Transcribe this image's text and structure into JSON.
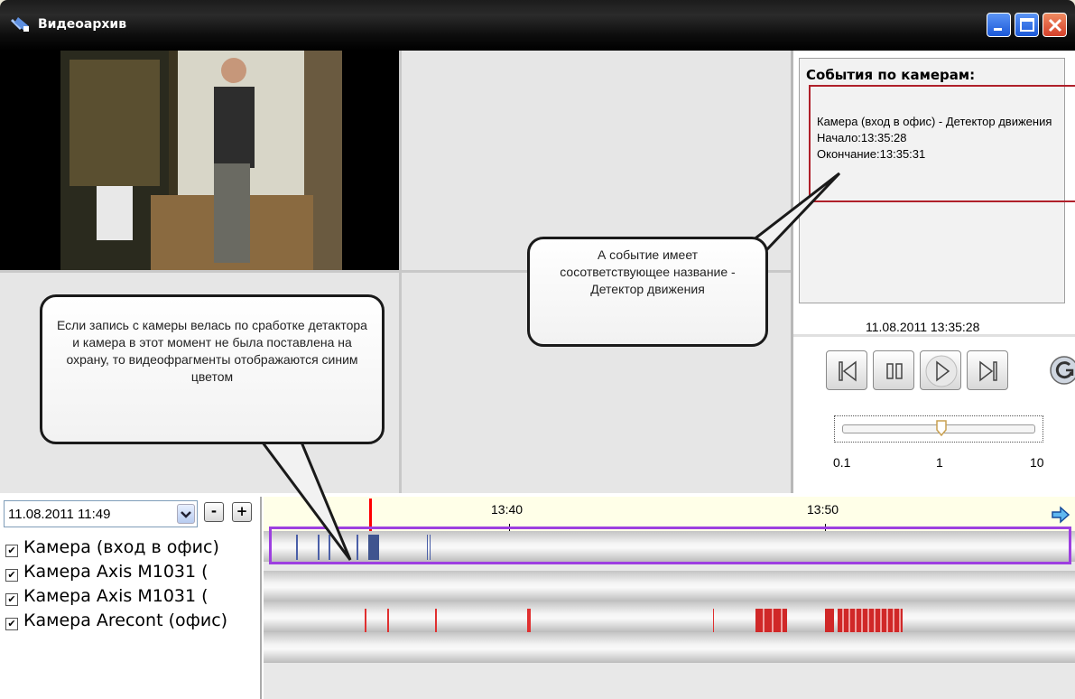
{
  "window": {
    "title": "Видеоархив"
  },
  "events": {
    "title": "События по камерам:",
    "entry": {
      "name": "Камера (вход в офис) - Детектор движения",
      "start": "Начало:13:35:28",
      "end": "Окончание:13:35:31"
    }
  },
  "player": {
    "datetime": "11.08.2011 13:35:28",
    "speed_labels": [
      "0.1",
      "1",
      "10"
    ],
    "speed_value": 1
  },
  "timeline": {
    "date_value": "11.08.2011 11:49",
    "minus_label": "-",
    "plus_label": "+",
    "tick_labels": [
      "13:40",
      "13:50"
    ],
    "cameras": [
      {
        "label": "Камера (вход в офис)",
        "checked": true
      },
      {
        "label": "Камера Axis M1031 (",
        "checked": true
      },
      {
        "label": "Камера Axis M1031 (",
        "checked": true
      },
      {
        "label": "Камера Arecont (офис)",
        "checked": true
      }
    ],
    "colors": {
      "blue_fragment": "#4a5fa8",
      "red_fragment": "#e03030",
      "cursor": "#ff0000",
      "selection": "#9d3fe0"
    }
  },
  "callouts": {
    "event_name": "А событие имеет сосответствующее название - Детектор движения",
    "blue_fragments": "Если  запись с камеры велась по сработке детактора и камера в этот момент не была поставлена на охрану, то видеофрагменты отображаются синим цветом"
  },
  "icons": [
    "app-icon",
    "minimize-icon",
    "maximize-icon",
    "close-icon",
    "skip-back-icon",
    "pause-icon",
    "play-icon",
    "skip-forward-icon",
    "refresh-icon",
    "dropdown-arrow-icon",
    "scroll-right-icon"
  ]
}
